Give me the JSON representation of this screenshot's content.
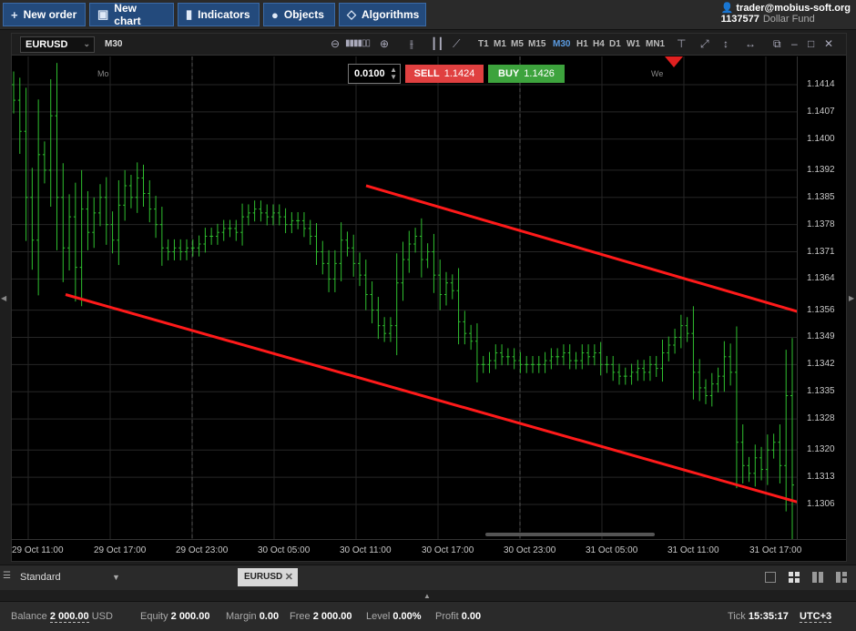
{
  "toolbar": {
    "buttons": [
      {
        "icon": "plus-icon",
        "label": "New order"
      },
      {
        "icon": "chart-icon",
        "label": "New chart"
      },
      {
        "icon": "bar-chart-icon",
        "label": "Indicators"
      },
      {
        "icon": "shapes-icon",
        "label": "Objects"
      },
      {
        "icon": "diamond-icon",
        "label": "Algorithms"
      }
    ],
    "account_user": "trader@mobius-soft.org",
    "account_number": "1137577",
    "account_fund": "Dollar Fund"
  },
  "chart": {
    "symbol": "EURUSD",
    "timeframe_label": "M30",
    "timeframes": [
      "T1",
      "M1",
      "M5",
      "M15",
      "M30",
      "H1",
      "H4",
      "D1",
      "W1",
      "MN1"
    ],
    "active_timeframe": "M30",
    "lot": "0.0100",
    "sell_label": "SELL",
    "sell_price": "1.1424",
    "buy_label": "BUY",
    "buy_price": "1.1426",
    "day_labels": [
      "Mo",
      "We"
    ],
    "colors": {
      "up": "#2fbf2f",
      "channel": "#ff1a1a",
      "sell": "#e04040",
      "buy": "#3da33d",
      "accent": "#5b9be0"
    }
  },
  "chart_data": {
    "type": "candlestick",
    "y_ticks": [
      1.1414,
      1.1407,
      1.14,
      1.1392,
      1.1385,
      1.1378,
      1.1371,
      1.1364,
      1.1356,
      1.1349,
      1.1342,
      1.1335,
      1.1328,
      1.132,
      1.1313,
      1.1306
    ],
    "x_ticks": [
      "29 Oct 11:00",
      "29 Oct 17:00",
      "29 Oct 23:00",
      "30 Oct 05:00",
      "30 Oct 11:00",
      "30 Oct 17:00",
      "30 Oct 23:00",
      "31 Oct 05:00",
      "31 Oct 11:00",
      "31 Oct 17:00"
    ],
    "ylim": [
      1.13,
      1.1422
    ],
    "grid": true,
    "close": [
      1.141,
      1.1402,
      1.1385,
      1.1374,
      1.1396,
      1.1392,
      1.1406,
      1.1385,
      1.1372,
      1.138,
      1.1367,
      1.1382,
      1.1376,
      1.1381,
      1.1385,
      1.1378,
      1.1374,
      1.1383,
      1.1388,
      1.1385,
      1.139,
      1.1386,
      1.1382,
      1.1378,
      1.1372,
      1.1371,
      1.1372,
      1.1371,
      1.1372,
      1.1372,
      1.1373,
      1.1375,
      1.1375,
      1.1376,
      1.1377,
      1.1377,
      1.1376,
      1.138,
      1.1381,
      1.1382,
      1.1381,
      1.138,
      1.1381,
      1.138,
      1.1378,
      1.1379,
      1.1379,
      1.1377,
      1.1375,
      1.1371,
      1.1368,
      1.1364,
      1.1368,
      1.1374,
      1.1372,
      1.1368,
      1.1365,
      1.136,
      1.1356,
      1.1352,
      1.135,
      1.1352,
      1.1363,
      1.1369,
      1.1373,
      1.1375,
      1.1369,
      1.1371,
      1.1365,
      1.136,
      1.1363,
      1.1361,
      1.1353,
      1.135,
      1.1348,
      1.1342,
      1.1342,
      1.1343,
      1.1345,
      1.1344,
      1.1344,
      1.1343,
      1.1342,
      1.1342,
      1.1342,
      1.1342,
      1.1343,
      1.1344,
      1.1344,
      1.1345,
      1.1343,
      1.1343,
      1.1345,
      1.1344,
      1.1345,
      1.1342,
      1.1342,
      1.134,
      1.1339,
      1.1339,
      1.134,
      1.1341,
      1.134,
      1.1342,
      1.1341,
      1.1345,
      1.1347,
      1.1349,
      1.1352,
      1.135,
      1.134,
      1.1336,
      1.1334,
      1.1337,
      1.1339,
      1.1344,
      1.134,
      1.1322,
      1.1316,
      1.1314,
      1.1318,
      1.1315,
      1.132,
      1.1322,
      1.1316,
      1.1334,
      1.1311
    ],
    "series": [
      {
        "name": "upper-channel",
        "from": {
          "time": "30 Oct 11:00",
          "price": 1.1388
        },
        "to": {
          "time": "31 Oct 19:00",
          "price": 1.1355
        }
      },
      {
        "name": "lower-channel",
        "from": {
          "time": "29 Oct 13:00",
          "price": 1.136
        },
        "to": {
          "time": "31 Oct 19:00",
          "price": 1.1306
        }
      }
    ]
  },
  "workspace": {
    "name": "Standard",
    "tab": "EURUSD"
  },
  "status": {
    "balance_label": "Balance",
    "balance_value": "2 000.00",
    "balance_ccy": "USD",
    "equity_label": "Equity",
    "equity_value": "2 000.00",
    "margin_label": "Margin",
    "margin_value": "0.00",
    "free_label": "Free",
    "free_value": "2 000.00",
    "level_label": "Level",
    "level_value": "0.00%",
    "profit_label": "Profit",
    "profit_value": "0.00",
    "tick_label": "Tick",
    "tick_time": "15:35:17",
    "timezone": "UTC+3"
  }
}
